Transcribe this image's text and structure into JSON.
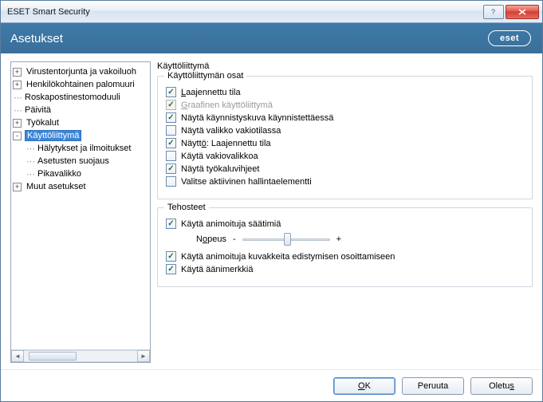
{
  "window": {
    "title": "ESET Smart Security"
  },
  "brand": {
    "section": "Asetukset",
    "logo": "eset"
  },
  "tree": {
    "items": [
      {
        "label": "Virustentorjunta ja vakoiluoh",
        "expand": "+",
        "depth": 0
      },
      {
        "label": "Henkilökohtainen palomuuri",
        "expand": "+",
        "depth": 0
      },
      {
        "label": "Roskapostinestomoduuli",
        "expand": "",
        "depth": 0
      },
      {
        "label": "Päivitä",
        "expand": "",
        "depth": 0
      },
      {
        "label": "Työkalut",
        "expand": "+",
        "depth": 0
      },
      {
        "label": "Käyttöliittymä",
        "expand": "-",
        "depth": 0,
        "selected": true
      },
      {
        "label": "Hälytykset ja ilmoitukset",
        "expand": "",
        "depth": 1
      },
      {
        "label": "Asetusten suojaus",
        "expand": "",
        "depth": 1
      },
      {
        "label": "Pikavalikko",
        "expand": "",
        "depth": 1
      },
      {
        "label": "Muut asetukset",
        "expand": "+",
        "depth": 0
      }
    ]
  },
  "content": {
    "heading": "Käyttöliittymä",
    "group1": {
      "legend": "Käyttöliittymän osat",
      "opts": [
        {
          "checked": true,
          "disabled": false,
          "prefix": "L",
          "rest": "aajennettu tila"
        },
        {
          "checked": true,
          "disabled": true,
          "prefix": "G",
          "rest": "raafinen käyttöliittymä"
        },
        {
          "checked": true,
          "disabled": false,
          "prefix": "",
          "rest": "Näytä käynnistyskuva käynnistettäessä"
        },
        {
          "checked": false,
          "disabled": false,
          "prefix": "",
          "rest": "Näytä valikko vakiotilassa"
        },
        {
          "checked": true,
          "disabled": false,
          "prefix": "Näytt",
          "mid": "ö",
          "rest": ": Laajennettu tila"
        },
        {
          "checked": false,
          "disabled": false,
          "prefix": "",
          "rest": "Käytä vakiovalikkoa"
        },
        {
          "checked": true,
          "disabled": false,
          "prefix": "",
          "rest": "Näytä työkaluvihjeet"
        },
        {
          "checked": false,
          "disabled": false,
          "prefix": "",
          "rest": "Valitse aktiivinen hallintaelementti"
        }
      ]
    },
    "group2": {
      "legend": "Tehosteet",
      "opts": [
        {
          "checked": true,
          "label": "Käytä animoituja säätimiä"
        }
      ],
      "speed": {
        "label_prefix": "N",
        "label_mid": "o",
        "label_rest": "peus",
        "minus": "-",
        "plus": "+"
      },
      "opts2": [
        {
          "checked": true,
          "label": "Käytä animoituja kuvakkeita edistymisen osoittamiseen"
        },
        {
          "checked": true,
          "label": "Käytä äänimerkkiä"
        }
      ]
    }
  },
  "footer": {
    "ok_prefix": "O",
    "ok_mid": "K",
    "cancel": "Peruuta",
    "default_prefix": "Oletu",
    "default_mid": "s"
  }
}
